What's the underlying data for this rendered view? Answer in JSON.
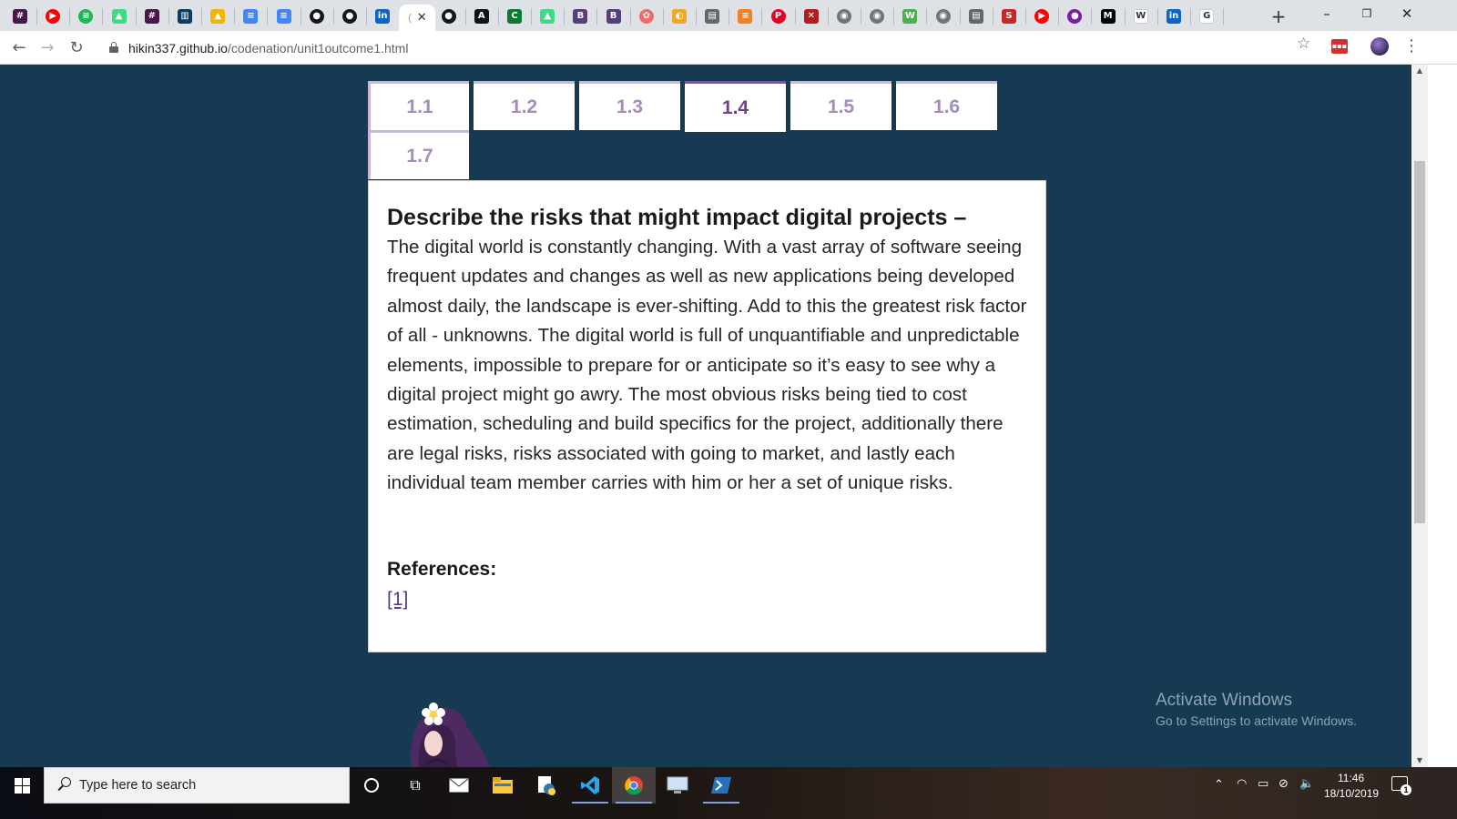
{
  "browser": {
    "tab_icons": [
      {
        "name": "slack-icon",
        "color": "#4a154b",
        "glyph": "#"
      },
      {
        "name": "youtube-icon",
        "color": "#ff0000",
        "glyph": "▶"
      },
      {
        "name": "spotify-icon",
        "color": "#1db954",
        "glyph": "≋"
      },
      {
        "name": "android-icon",
        "color": "#3ddc84",
        "glyph": "▲"
      },
      {
        "name": "slack-icon",
        "color": "#4a154b",
        "glyph": "#"
      },
      {
        "name": "trello-icon",
        "color": "#0b3c5d",
        "glyph": "▥"
      },
      {
        "name": "google-drive-icon",
        "color": "#f4b400",
        "glyph": "▲"
      },
      {
        "name": "google-docs-icon",
        "color": "#4285f4",
        "glyph": "≡"
      },
      {
        "name": "google-docs-icon",
        "color": "#4285f4",
        "glyph": "≡"
      },
      {
        "name": "github-icon",
        "color": "#181717",
        "glyph": "●"
      },
      {
        "name": "github-icon",
        "color": "#181717",
        "glyph": "●"
      },
      {
        "name": "linkedin-icon",
        "color": "#0a66c2",
        "glyph": "in"
      },
      {
        "name": "github-icon",
        "color": "#181717",
        "glyph": "●"
      },
      {
        "name": "devto-icon",
        "color": "#111111",
        "glyph": "A"
      },
      {
        "name": "terminal-icon",
        "color": "#0a7a2e",
        "glyph": "C"
      },
      {
        "name": "android-icon",
        "color": "#3ddc84",
        "glyph": "▲"
      },
      {
        "name": "bootstrap-icon",
        "color": "#563d7c",
        "glyph": "B"
      },
      {
        "name": "bootstrap-icon",
        "color": "#563d7c",
        "glyph": "B"
      },
      {
        "name": "asana-icon",
        "color": "#f06a6a",
        "glyph": "✿"
      },
      {
        "name": "duck-icon",
        "color": "#f5a623",
        "glyph": "◐"
      },
      {
        "name": "docs-icon",
        "color": "#666666",
        "glyph": "▤"
      },
      {
        "name": "stackoverflow-icon",
        "color": "#f48024",
        "glyph": "≡"
      },
      {
        "name": "pinterest-icon",
        "color": "#e60023",
        "glyph": "P"
      },
      {
        "name": "game-icon",
        "color": "#b71c1c",
        "glyph": "✕"
      },
      {
        "name": "globe-icon",
        "color": "#757575",
        "glyph": "◉"
      },
      {
        "name": "globe-icon",
        "color": "#757575",
        "glyph": "◉"
      },
      {
        "name": "w3schools-icon",
        "color": "#4caf50",
        "glyph": "W"
      },
      {
        "name": "globe-icon",
        "color": "#757575",
        "glyph": "◉"
      },
      {
        "name": "docs-icon",
        "color": "#666666",
        "glyph": "▤"
      },
      {
        "name": "scribd-icon",
        "color": "#c62828",
        "glyph": "S"
      },
      {
        "name": "youtube-icon",
        "color": "#ff0000",
        "glyph": "▶"
      },
      {
        "name": "circle-icon",
        "color": "#7b1fa2",
        "glyph": "●"
      },
      {
        "name": "medium-icon",
        "color": "#000000",
        "glyph": "M"
      },
      {
        "name": "wikipedia-icon",
        "color": "#ffffff",
        "glyph": "W"
      },
      {
        "name": "linkedin-icon",
        "color": "#0a66c2",
        "glyph": "in"
      },
      {
        "name": "google-icon",
        "color": "#ffffff",
        "glyph": "G"
      }
    ],
    "url_host": "hikin337.github.io",
    "url_path": "/codenation/unit1outcome1.html"
  },
  "page": {
    "tabs": [
      "1.1",
      "1.2",
      "1.3",
      "1.4",
      "1.5",
      "1.6",
      "1.7"
    ],
    "active_tab": "1.4",
    "heading": "Describe the risks that might impact digital projects –",
    "body": "The digital world is constantly changing. With a vast array of software seeing frequent updates and changes as well as new applications being developed almost daily, the landscape is ever-shifting. Add to this the greatest risk factor of all - unknowns. The digital world is full of unquantifiable and unpredictable elements, impossible to prepare for or anticipate so it’s easy to see why a digital project might go awry. The most obvious risks being tied to cost estimation, scheduling and build specifics for the project, additionally there are legal risks, risks associated with going to market, and lastly each individual team member carries with him or her a set of unique risks.",
    "references_label": "References:",
    "reference_link": "[1]"
  },
  "watermark": {
    "title": "Activate Windows",
    "subtitle": "Go to Settings to activate Windows."
  },
  "taskbar": {
    "search_placeholder": "Type here to search",
    "time": "11:46",
    "date": "18/10/2019",
    "notification_count": "1"
  },
  "colors": {
    "page_background": "#163a52",
    "tab_text": "#a78bbf",
    "tab_active_text": "#6f3f91",
    "link": "#5a3a8a"
  }
}
